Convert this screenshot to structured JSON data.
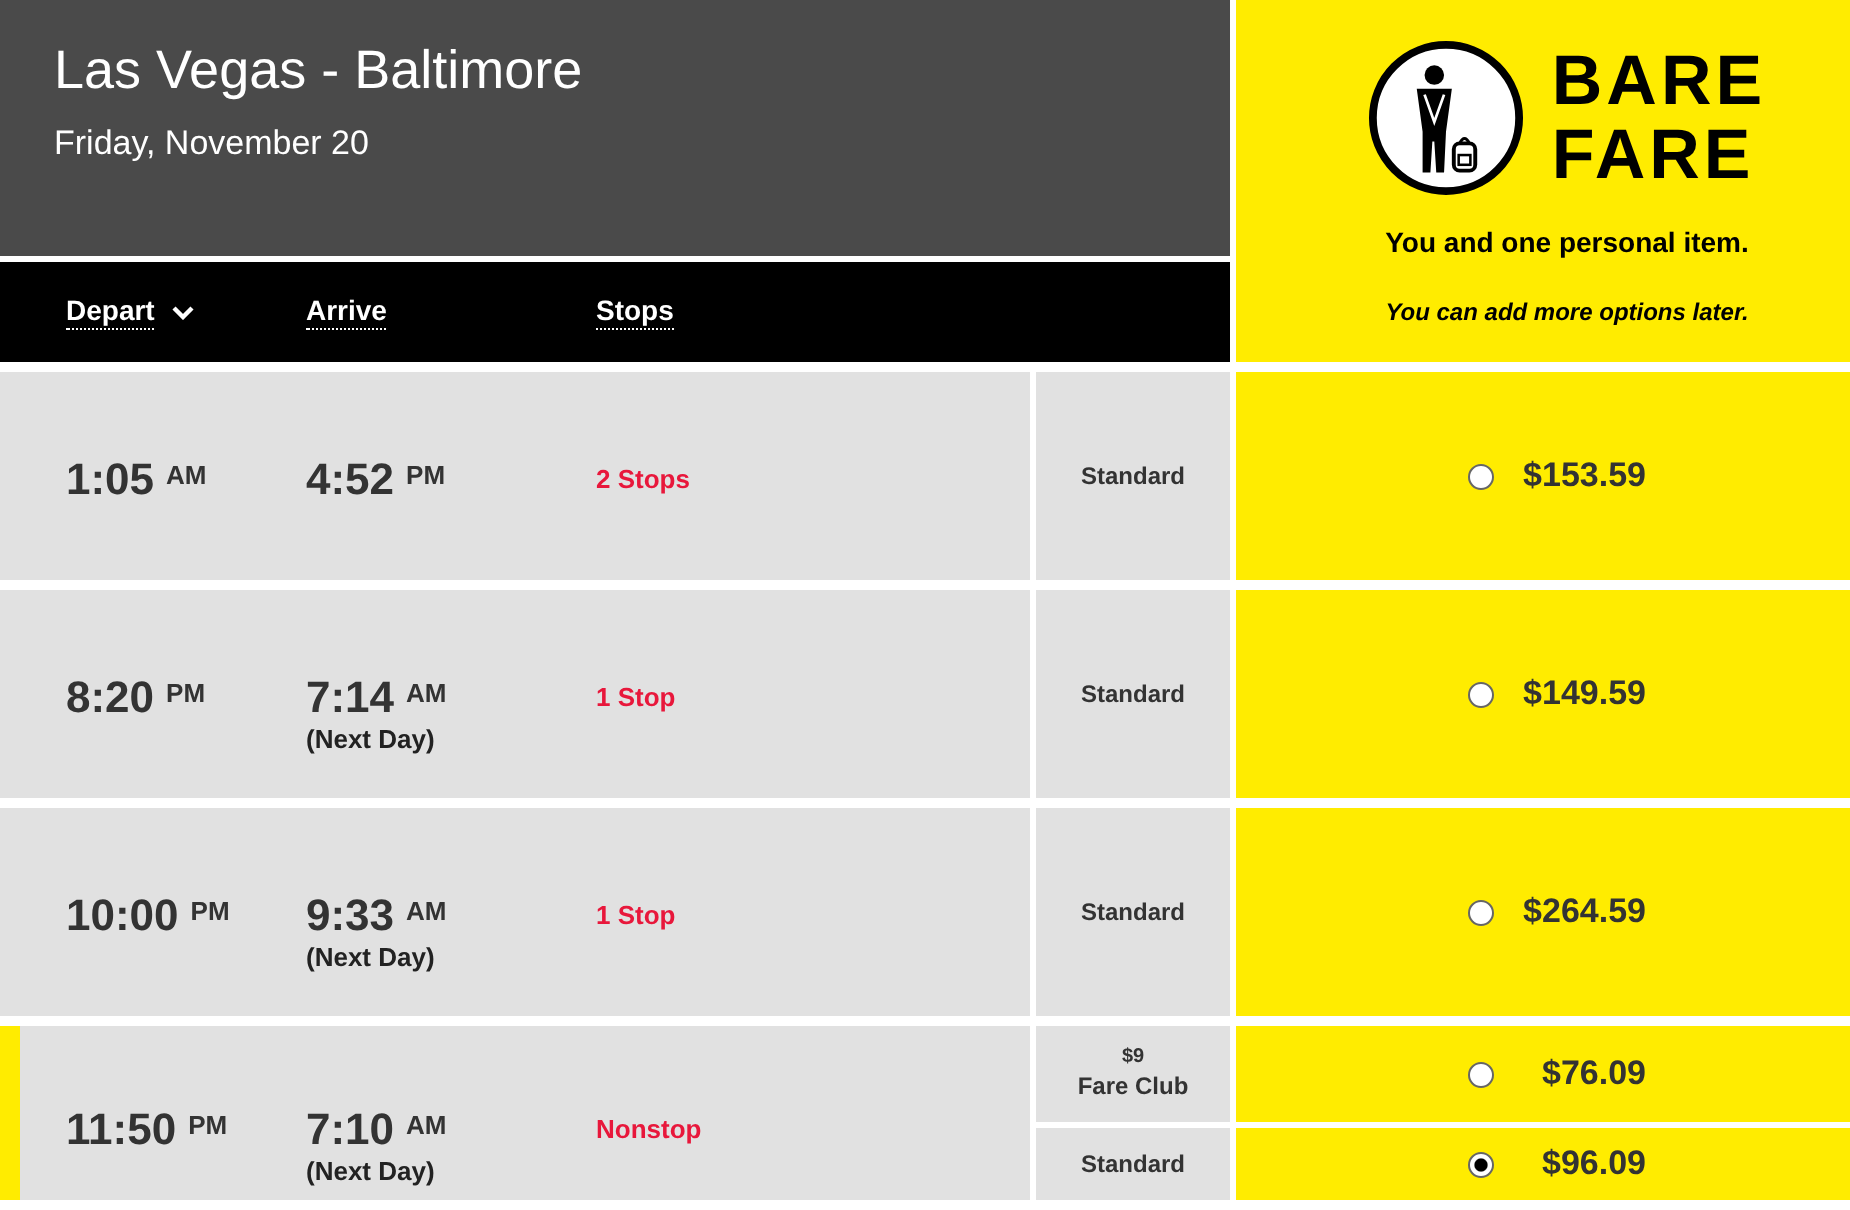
{
  "header": {
    "route": "Las Vegas - Baltimore",
    "date": "Friday, November 20"
  },
  "columns": [
    {
      "label": "Depart",
      "sorted": true
    },
    {
      "label": "Arrive",
      "sorted": false
    },
    {
      "label": "Stops",
      "sorted": false
    }
  ],
  "fare_panel": {
    "title": "BARE FARE",
    "tagline": "You and one personal item.",
    "note": "You can add more options later."
  },
  "flights": [
    {
      "selected": false,
      "depart": {
        "time": "1:05",
        "period": "AM"
      },
      "arrive": {
        "time": "4:52",
        "period": "PM"
      },
      "stops": "2 Stops",
      "fares": [
        {
          "type": "Standard",
          "price": "$153.59",
          "selected": false
        }
      ]
    },
    {
      "selected": false,
      "depart": {
        "time": "8:20",
        "period": "PM"
      },
      "arrive": {
        "time": "7:14",
        "period": "AM",
        "note": "(Next Day)"
      },
      "stops": "1 Stop",
      "fares": [
        {
          "type": "Standard",
          "price": "$149.59",
          "selected": false
        }
      ]
    },
    {
      "selected": false,
      "depart": {
        "time": "10:00",
        "period": "PM"
      },
      "arrive": {
        "time": "9:33",
        "period": "AM",
        "note": "(Next Day)"
      },
      "stops": "1 Stop",
      "fares": [
        {
          "type": "Standard",
          "price": "$264.59",
          "selected": false
        }
      ]
    },
    {
      "selected": true,
      "depart": {
        "time": "11:50",
        "period": "PM"
      },
      "arrive": {
        "time": "7:10",
        "period": "AM",
        "note": "(Next Day)"
      },
      "stops": "Nonstop",
      "fares": [
        {
          "badge": "$9",
          "type": "Fare Club",
          "price": "$76.09",
          "selected": false
        },
        {
          "type": "Standard",
          "price": "$96.09",
          "selected": true
        }
      ]
    }
  ]
}
